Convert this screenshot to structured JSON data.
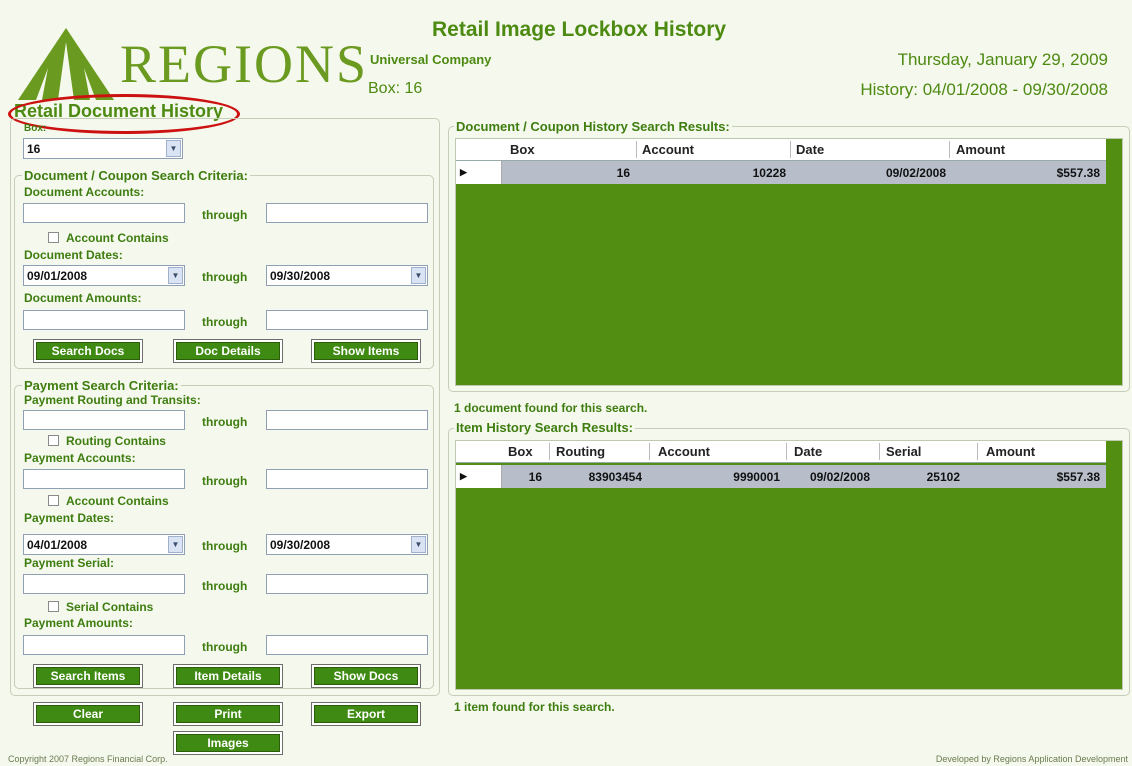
{
  "header": {
    "brand": "REGIONS",
    "title": "Retail Image Lockbox History",
    "company": "Universal Company",
    "box": "Box: 16",
    "date": "Thursday, January 29, 2009",
    "history_range": "History: 04/01/2008 - 09/30/2008"
  },
  "section_title": "Retail Document History",
  "box_field": {
    "label": "Box:",
    "value": "16"
  },
  "doc_criteria": {
    "legend": "Document / Coupon Search Criteria:",
    "accounts_label": "Document Accounts:",
    "through": "through",
    "account_contains": "Account Contains",
    "dates_label": "Document Dates:",
    "date_from": "09/01/2008",
    "date_to": "09/30/2008",
    "amounts_label": "Document Amounts:",
    "btn_search": "Search Docs",
    "btn_details": "Doc Details",
    "btn_show": "Show Items"
  },
  "pay_criteria": {
    "legend": "Payment Search Criteria:",
    "routing_label": "Payment Routing and Transits:",
    "routing_contains": "Routing Contains",
    "accounts_label": "Payment Accounts:",
    "account_contains": "Account Contains",
    "dates_label": "Payment Dates:",
    "date_from": "04/01/2008",
    "date_to": "09/30/2008",
    "serial_label": "Payment Serial:",
    "serial_contains": "Serial Contains",
    "amounts_label": "Payment Amounts:",
    "btn_search": "Search Items",
    "btn_details": "Item Details",
    "btn_show": "Show Docs"
  },
  "actions": {
    "clear": "Clear",
    "print": "Print",
    "export": "Export",
    "images": "Images"
  },
  "doc_results": {
    "legend": "Document / Coupon History Search Results:",
    "columns": [
      "Box",
      "Account",
      "Date",
      "Amount"
    ],
    "rows": [
      {
        "box": "16",
        "account": "10228",
        "date": "09/02/2008",
        "amount": "$557.38"
      }
    ],
    "status": "1 document found for this search."
  },
  "item_results": {
    "legend": "Item History Search Results:",
    "columns": [
      "Box",
      "Routing",
      "Account",
      "Date",
      "Serial",
      "Amount"
    ],
    "rows": [
      {
        "box": "16",
        "routing": "83903454",
        "account": "9990001",
        "date": "09/02/2008",
        "serial": "25102",
        "amount": "$557.38"
      }
    ],
    "status": "1 item found for this search."
  },
  "footer": {
    "copyright": "Copyright 2007 Regions Financial Corp.",
    "developed": "Developed by Regions Application Development"
  },
  "colors": {
    "brand_green": "#4d8a12",
    "grid_green": "#518e12",
    "highlight_red": "#cc1111"
  }
}
